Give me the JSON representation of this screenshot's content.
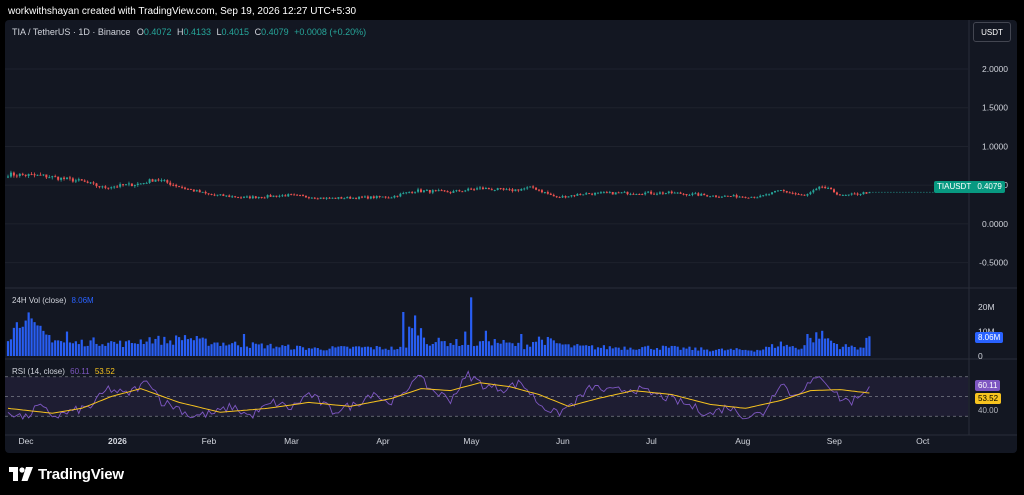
{
  "header": {
    "caption": "workwithshayan created with TradingView.com, Sep 19, 2026 12:27 UTC+5:30"
  },
  "legend": {
    "symbol": "TIA / TetherUS · 1D · Binance",
    "open_label": "O",
    "open": "0.4072",
    "high_label": "H",
    "high": "0.4133",
    "low_label": "L",
    "low": "0.4015",
    "close_label": "C",
    "close": "0.4079",
    "change": "+0.0008 (+0.20%)"
  },
  "currency_button": "USDT",
  "price_tag": {
    "symbol": "TIAUSDT",
    "value": "0.4079"
  },
  "volume_legend": {
    "label": "24H Vol (close)",
    "value": "8.06M"
  },
  "volume_tag": "8.06M",
  "rsi_legend": {
    "label": "RSI (14, close)",
    "rsi_value": "60.11",
    "ma_value": "53.52"
  },
  "rsi_tags": {
    "rsi": "60.11",
    "ma": "53.52",
    "level": "40.00"
  },
  "brand": {
    "name": "TradingView"
  },
  "colors": {
    "up": "#26a69a",
    "down": "#ef5350",
    "volume": "#2962ff",
    "rsi": "#7e57c2",
    "rsi_ma": "#f7c31f",
    "tag_bg": "#089981",
    "bg": "#131722"
  },
  "chart_data": {
    "type": "candlestick",
    "symbol": "TIA / TetherUS",
    "interval": "1D",
    "price_axis": {
      "ticks": [
        "2.0000",
        "1.5000",
        "1.0000",
        "0.5000",
        "0.0000",
        "-0.5000"
      ],
      "tick_values": [
        2.0,
        1.5,
        1.0,
        0.5,
        0.0,
        -0.5
      ],
      "ylim": [
        -0.75,
        2.4
      ]
    },
    "volume_axis": {
      "ticks": [
        "20M",
        "10M",
        "0"
      ],
      "tick_values": [
        20,
        10,
        0
      ],
      "ylim": [
        0,
        27
      ]
    },
    "rsi_axis": {
      "ticks": [
        "40.00"
      ],
      "levels": [
        70,
        50,
        30
      ],
      "ylim": [
        14,
        86
      ]
    },
    "time_axis": {
      "labels": [
        "Dec",
        "2026",
        "Feb",
        "Mar",
        "Apr",
        "May",
        "Jun",
        "Jul",
        "Aug",
        "Sep",
        "Oct"
      ],
      "day_index": [
        0,
        31,
        62,
        90,
        121,
        151,
        182,
        212,
        243,
        274,
        304
      ]
    },
    "candle_count": 293,
    "close_anchors": [
      [
        0,
        0.64
      ],
      [
        12,
        0.62
      ],
      [
        25,
        0.55
      ],
      [
        32,
        0.47
      ],
      [
        45,
        0.52
      ],
      [
        50,
        0.58
      ],
      [
        60,
        0.46
      ],
      [
        68,
        0.38
      ],
      [
        80,
        0.34
      ],
      [
        95,
        0.37
      ],
      [
        108,
        0.33
      ],
      [
        120,
        0.34
      ],
      [
        130,
        0.35
      ],
      [
        138,
        0.43
      ],
      [
        150,
        0.41
      ],
      [
        160,
        0.46
      ],
      [
        170,
        0.43
      ],
      [
        178,
        0.47
      ],
      [
        186,
        0.34
      ],
      [
        195,
        0.39
      ],
      [
        210,
        0.4
      ],
      [
        225,
        0.4
      ],
      [
        240,
        0.36
      ],
      [
        255,
        0.35
      ],
      [
        262,
        0.43
      ],
      [
        270,
        0.36
      ],
      [
        276,
        0.48
      ],
      [
        283,
        0.36
      ],
      [
        292,
        0.41
      ]
    ],
    "volume_anchors_m": [
      [
        0,
        8
      ],
      [
        4,
        14
      ],
      [
        6,
        20
      ],
      [
        8,
        12
      ],
      [
        12,
        9
      ],
      [
        20,
        5
      ],
      [
        30,
        6
      ],
      [
        40,
        5
      ],
      [
        48,
        7
      ],
      [
        55,
        6
      ],
      [
        60,
        8
      ],
      [
        65,
        6
      ],
      [
        75,
        5
      ],
      [
        90,
        4
      ],
      [
        105,
        3
      ],
      [
        120,
        3.5
      ],
      [
        135,
        3
      ],
      [
        138,
        14
      ],
      [
        142,
        6
      ],
      [
        160,
        5
      ],
      [
        162,
        8
      ],
      [
        164,
        6
      ],
      [
        175,
        4
      ],
      [
        180,
        7
      ],
      [
        190,
        4
      ],
      [
        200,
        3.5
      ],
      [
        220,
        3.5
      ],
      [
        240,
        2.5
      ],
      [
        255,
        2.5
      ],
      [
        262,
        5
      ],
      [
        268,
        3
      ],
      [
        275,
        9
      ],
      [
        282,
        4
      ],
      [
        290,
        3.5
      ],
      [
        292,
        8.06
      ]
    ],
    "volume_spikes_m": [
      [
        20,
        10
      ],
      [
        80,
        9
      ],
      [
        134,
        18
      ],
      [
        136,
        12
      ],
      [
        155,
        10
      ],
      [
        157,
        24
      ],
      [
        174,
        9
      ],
      [
        271,
        9
      ]
    ],
    "rsi_anchors": [
      [
        0,
        35
      ],
      [
        6,
        28
      ],
      [
        10,
        40
      ],
      [
        16,
        30
      ],
      [
        22,
        35
      ],
      [
        28,
        40
      ],
      [
        34,
        58
      ],
      [
        40,
        52
      ],
      [
        48,
        66
      ],
      [
        52,
        45
      ],
      [
        58,
        38
      ],
      [
        62,
        30
      ],
      [
        70,
        33
      ],
      [
        76,
        40
      ],
      [
        82,
        30
      ],
      [
        90,
        44
      ],
      [
        96,
        38
      ],
      [
        102,
        53
      ],
      [
        110,
        35
      ],
      [
        118,
        42
      ],
      [
        124,
        55
      ],
      [
        128,
        44
      ],
      [
        134,
        50
      ],
      [
        138,
        72
      ],
      [
        144,
        56
      ],
      [
        150,
        47
      ],
      [
        156,
        72
      ],
      [
        162,
        60
      ],
      [
        168,
        58
      ],
      [
        174,
        64
      ],
      [
        180,
        43
      ],
      [
        186,
        32
      ],
      [
        192,
        44
      ],
      [
        198,
        60
      ],
      [
        204,
        55
      ],
      [
        212,
        58
      ],
      [
        222,
        50
      ],
      [
        230,
        42
      ],
      [
        238,
        32
      ],
      [
        244,
        40
      ],
      [
        250,
        30
      ],
      [
        256,
        33
      ],
      [
        262,
        66
      ],
      [
        266,
        50
      ],
      [
        270,
        60
      ],
      [
        276,
        70
      ],
      [
        282,
        48
      ],
      [
        286,
        45
      ],
      [
        292,
        60.11
      ]
    ],
    "rsi_ma_anchors": [
      [
        0,
        38
      ],
      [
        15,
        33
      ],
      [
        25,
        38
      ],
      [
        35,
        50
      ],
      [
        45,
        58
      ],
      [
        58,
        44
      ],
      [
        72,
        34
      ],
      [
        88,
        38
      ],
      [
        102,
        44
      ],
      [
        116,
        40
      ],
      [
        130,
        48
      ],
      [
        140,
        58
      ],
      [
        150,
        56
      ],
      [
        160,
        64
      ],
      [
        170,
        60
      ],
      [
        180,
        52
      ],
      [
        190,
        40
      ],
      [
        200,
        48
      ],
      [
        212,
        56
      ],
      [
        225,
        52
      ],
      [
        238,
        42
      ],
      [
        250,
        38
      ],
      [
        262,
        46
      ],
      [
        272,
        56
      ],
      [
        282,
        57
      ],
      [
        292,
        53.52
      ]
    ]
  }
}
